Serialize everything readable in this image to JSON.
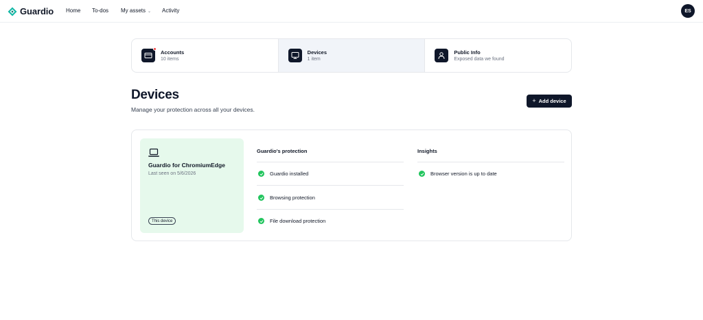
{
  "brand": {
    "name": "Guardio",
    "color": "#14b8a6"
  },
  "nav": {
    "home": "Home",
    "todos": "To-dos",
    "assets": "My assets",
    "activity": "Activity"
  },
  "user": {
    "initials": "ES"
  },
  "categories": [
    {
      "title": "Accounts",
      "subtitle": "10 items",
      "icon": "credit-card-icon",
      "alert": true
    },
    {
      "title": "Devices",
      "subtitle": "1 item",
      "icon": "monitor-icon",
      "active": true
    },
    {
      "title": "Public Info",
      "subtitle": "Exposed data we found",
      "icon": "user-icon"
    }
  ],
  "header": {
    "title": "Devices",
    "subtitle": "Manage your protection across all your devices.",
    "add_label": "Add device"
  },
  "device": {
    "name": "Guardio for ChromiumEdge",
    "last_seen": "Last seen on 5/6/2026",
    "tag": "This device",
    "protection_title": "Guardio's protection",
    "protection_items": [
      "Guardio installed",
      "Browsing protection",
      "File download protection"
    ],
    "insights_title": "Insights",
    "insight_items": [
      "Browser version is up to date"
    ]
  },
  "colors": {
    "accent_dark": "#0f172a",
    "success": "#22c55e",
    "card_bg": "#e6f9ec",
    "alert": "#ef4444"
  }
}
